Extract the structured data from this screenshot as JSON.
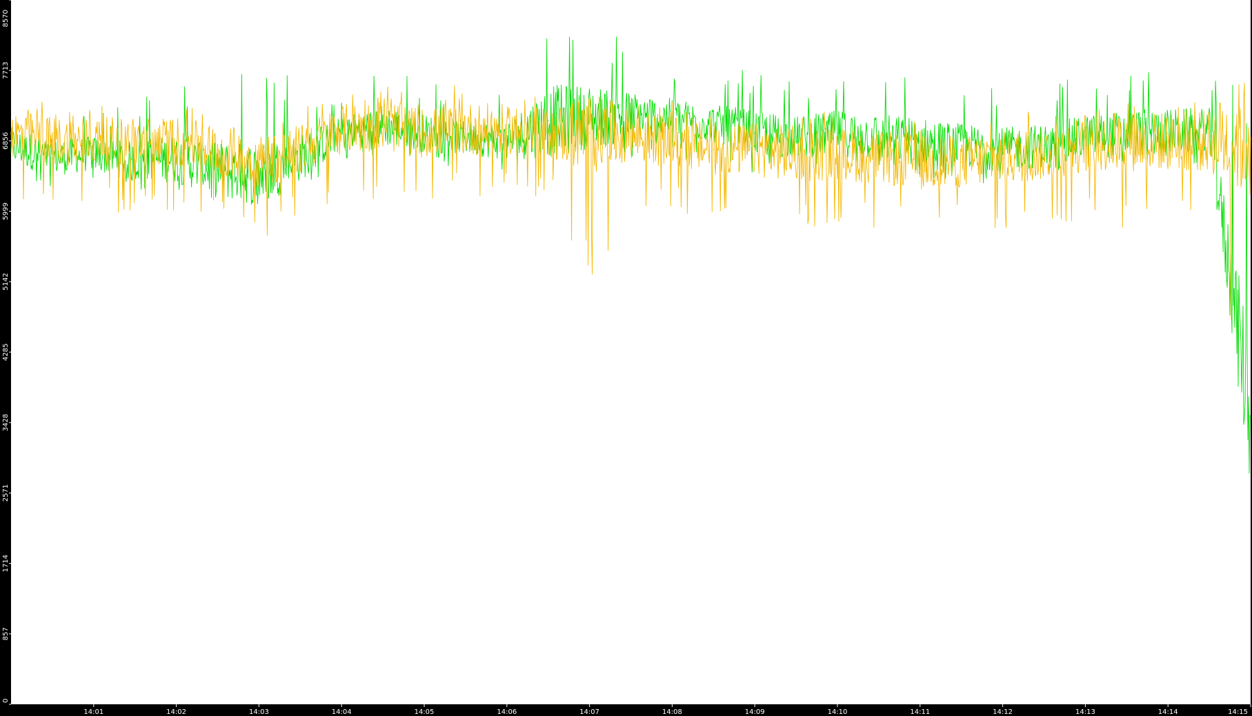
{
  "chart_data": {
    "type": "line",
    "title": "",
    "xlabel": "",
    "ylabel": "",
    "ylim": [
      0,
      8570
    ],
    "y_ticks": [
      "0",
      "857",
      "1714",
      "2571",
      "3428",
      "4285",
      "5142",
      "5999",
      "6856",
      "7713",
      "8570"
    ],
    "x_ticks": [
      "14:01",
      "14:02",
      "14:03",
      "14:04",
      "14:05",
      "14:06",
      "14:07",
      "14:08",
      "14:09",
      "14:10",
      "14:11",
      "14:12",
      "14:13",
      "14:14",
      "14:15"
    ],
    "x_range": [
      "14:00:00",
      "14:15:00"
    ],
    "grid": false,
    "legend": "none",
    "background": "#ffffff",
    "series": [
      {
        "color": "#00dd00",
        "x": [
          "14:00:00",
          "14:00:30",
          "14:01:00",
          "14:01:30",
          "14:02:00",
          "14:02:30",
          "14:03:00",
          "14:03:30",
          "14:04:00",
          "14:04:30",
          "14:05:00",
          "14:05:30",
          "14:06:00",
          "14:06:30",
          "14:07:00",
          "14:07:30",
          "14:08:00",
          "14:08:30",
          "14:09:00",
          "14:09:30",
          "14:10:00",
          "14:10:30",
          "14:11:00",
          "14:11:30",
          "14:12:00",
          "14:12:30",
          "14:13:00",
          "14:13:30",
          "14:14:00",
          "14:14:30",
          "14:15:00"
        ],
        "values": [
          6800,
          6650,
          6700,
          6600,
          6650,
          6500,
          6450,
          6650,
          6950,
          7050,
          6950,
          6900,
          6850,
          7100,
          7150,
          7150,
          7150,
          7050,
          6950,
          6900,
          6950,
          6900,
          6850,
          6800,
          6750,
          6800,
          6900,
          6950,
          6950,
          7000,
          3500
        ],
        "min": [
          6300,
          6250,
          6300,
          6250,
          6200,
          6100,
          6050,
          6300,
          6550,
          6600,
          6550,
          6500,
          6450,
          6600,
          6700,
          6650,
          6650,
          6550,
          6450,
          6400,
          6450,
          6400,
          6350,
          6350,
          6300,
          6350,
          6450,
          6500,
          6500,
          6550,
          3400
        ],
        "max": [
          7300,
          7250,
          7250,
          7350,
          7550,
          7650,
          7800,
          7600,
          7450,
          7750,
          7600,
          7450,
          7500,
          8570,
          8450,
          8050,
          7650,
          7650,
          7750,
          7550,
          7700,
          7700,
          7650,
          7550,
          7500,
          7550,
          7650,
          7750,
          7850,
          7700,
          7500
        ]
      },
      {
        "color": "#f5b800",
        "x": [
          "14:00:00",
          "14:00:30",
          "14:01:00",
          "14:01:30",
          "14:02:00",
          "14:02:30",
          "14:03:00",
          "14:03:30",
          "14:04:00",
          "14:04:30",
          "14:05:00",
          "14:05:30",
          "14:06:00",
          "14:06:30",
          "14:07:00",
          "14:07:30",
          "14:08:00",
          "14:08:30",
          "14:09:00",
          "14:09:30",
          "14:10:00",
          "14:10:30",
          "14:11:00",
          "14:11:30",
          "14:12:00",
          "14:12:30",
          "14:13:00",
          "14:13:30",
          "14:14:00",
          "14:14:30",
          "14:15:00"
        ],
        "values": [
          6950,
          6850,
          6850,
          6850,
          6850,
          6750,
          6600,
          6750,
          7000,
          7050,
          6950,
          7000,
          7000,
          6950,
          6950,
          6900,
          6850,
          6750,
          6750,
          6700,
          6700,
          6650,
          6600,
          6600,
          6650,
          6700,
          6800,
          6850,
          6850,
          6850,
          6900
        ],
        "min": [
          6050,
          6000,
          6000,
          5950,
          5950,
          5900,
          5650,
          5900,
          6150,
          6150,
          6150,
          6100,
          6100,
          6150,
          5120,
          6000,
          5950,
          5900,
          5850,
          5700,
          5800,
          5750,
          5650,
          5800,
          5750,
          5800,
          5850,
          5700,
          5800,
          5750,
          3700
        ],
        "max": [
          7350,
          7350,
          7300,
          7300,
          7300,
          7250,
          7150,
          7250,
          7500,
          7550,
          7500,
          7550,
          7450,
          7450,
          7400,
          7400,
          7350,
          7300,
          7300,
          7250,
          7250,
          7200,
          7200,
          7200,
          7200,
          7250,
          7300,
          7350,
          7400,
          7450,
          7300
        ]
      }
    ]
  }
}
